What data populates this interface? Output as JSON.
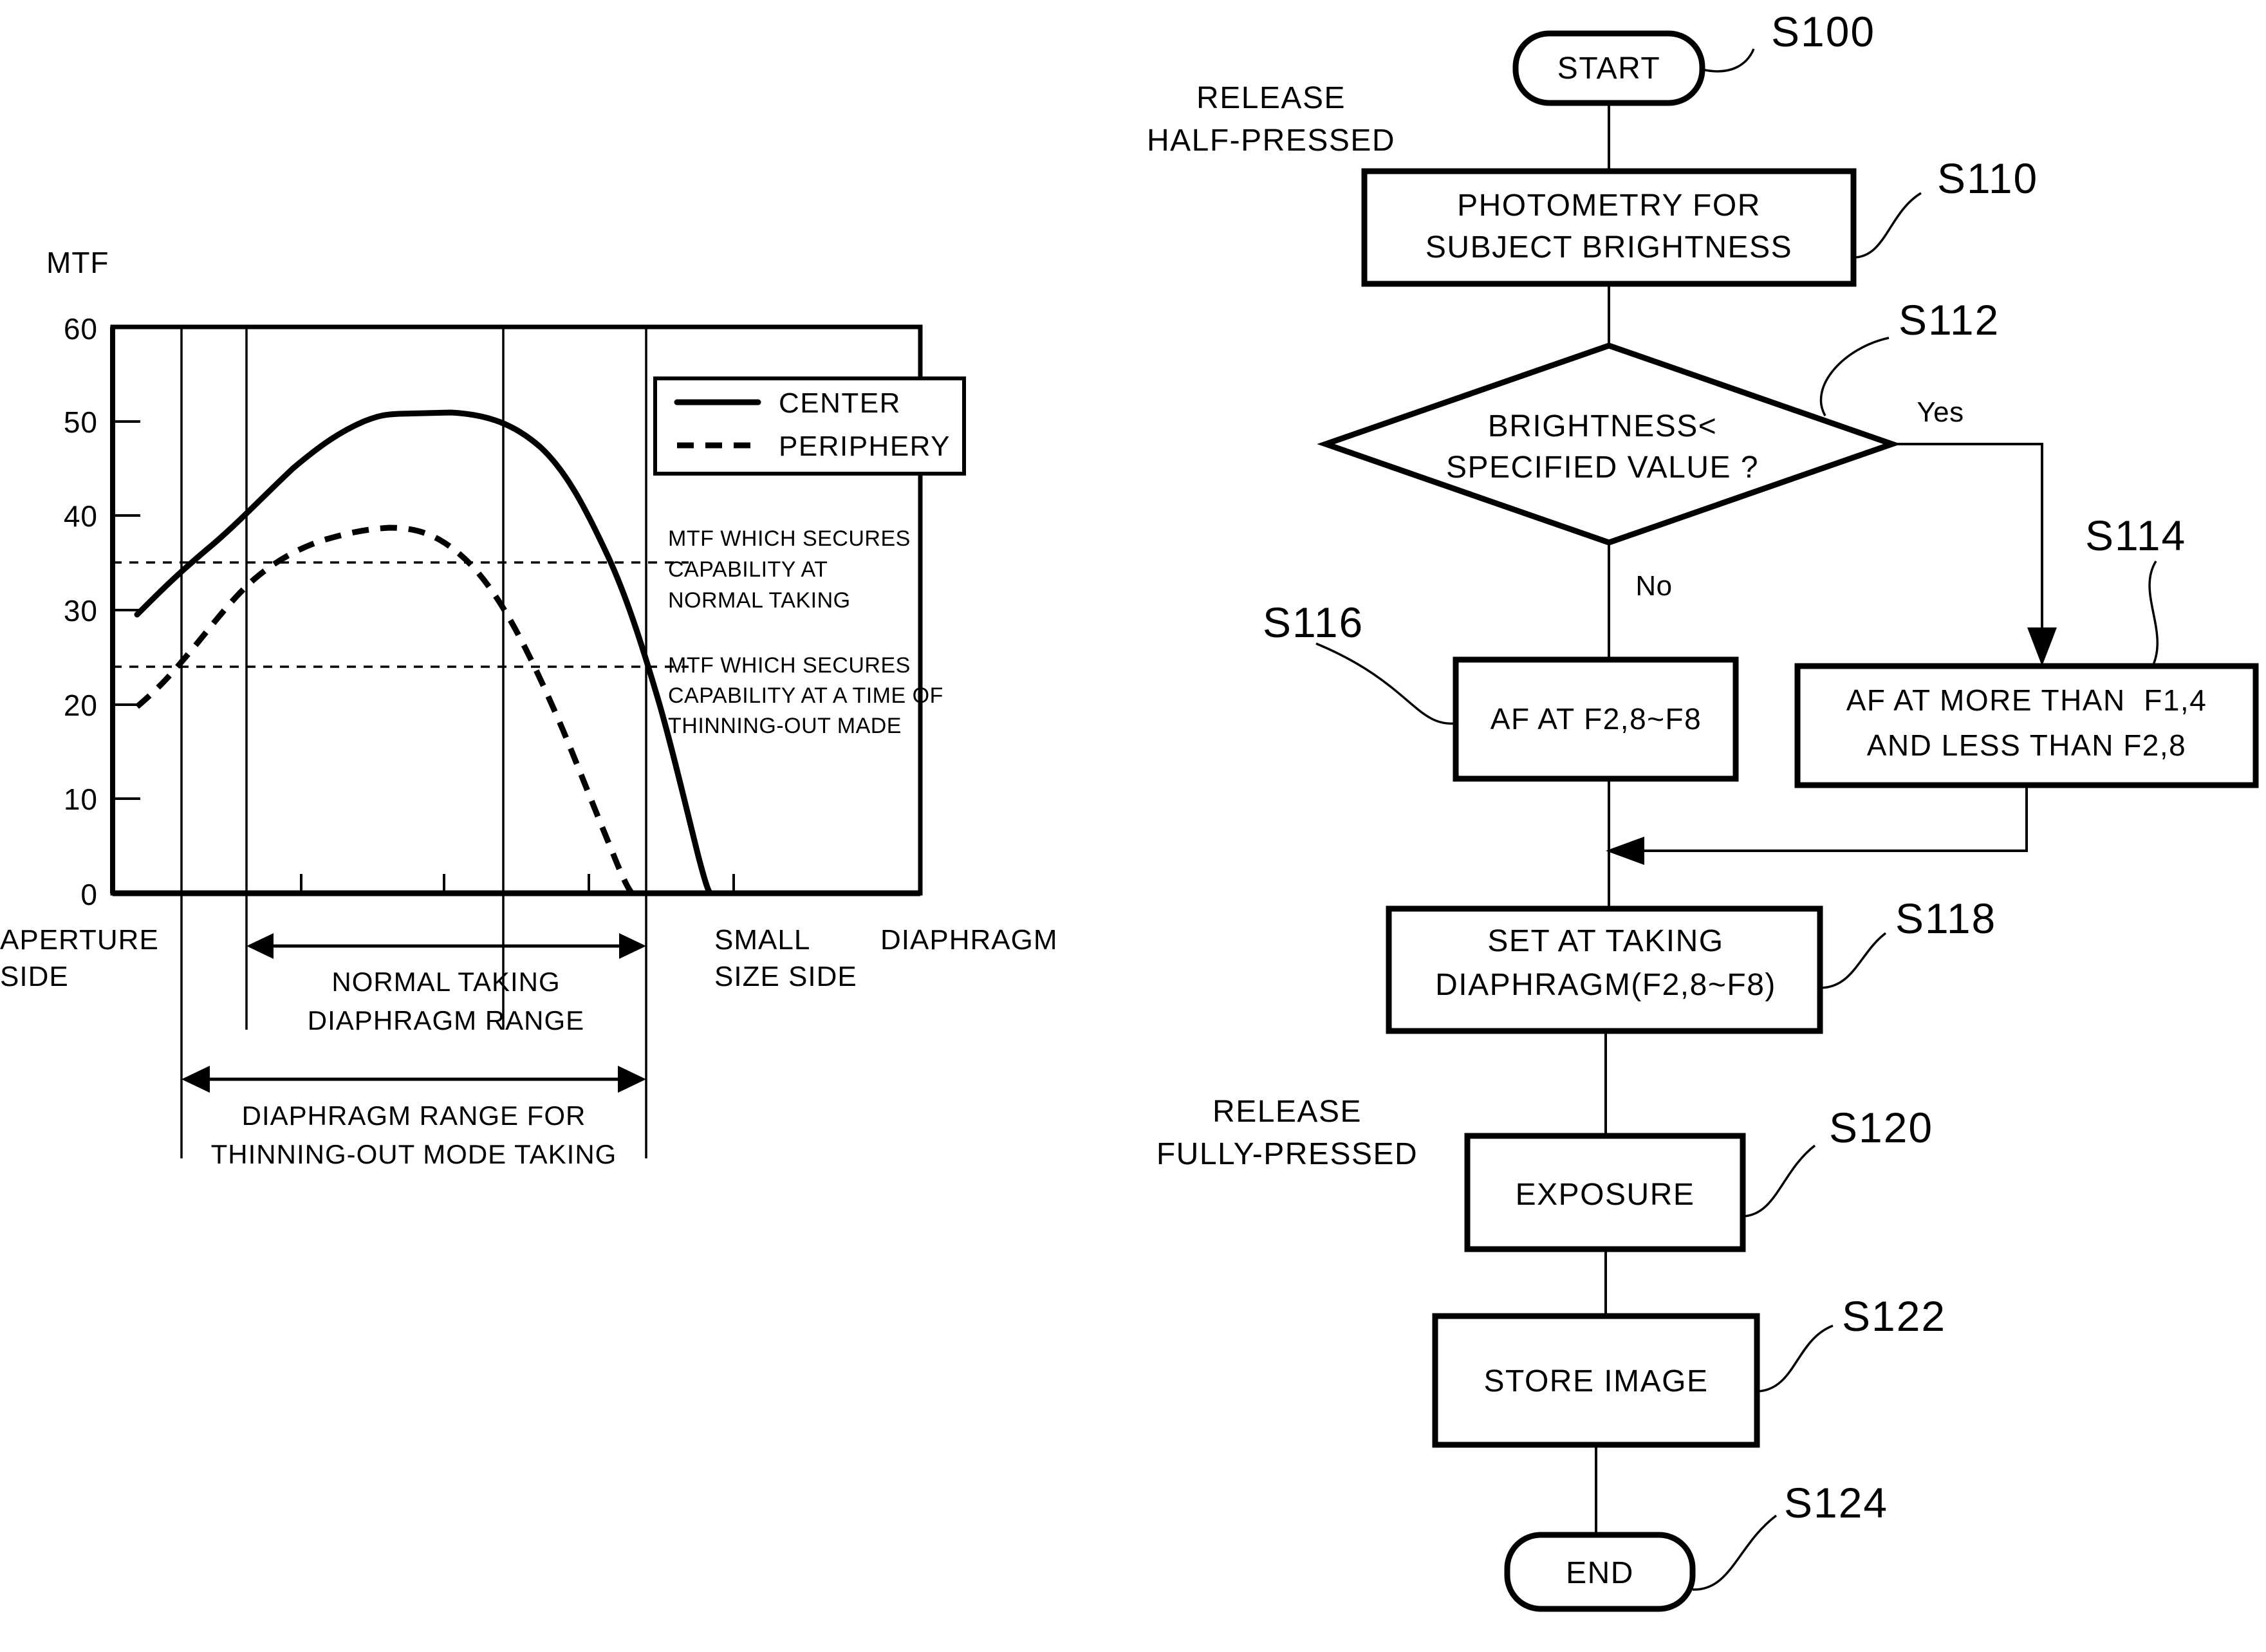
{
  "figure": {
    "type": "patent-figure",
    "panels": [
      "mtf-graph",
      "flowchart"
    ]
  },
  "chart_data": {
    "type": "line",
    "title": "",
    "ylabel": "MTF",
    "xlabel": "DIAPHRAGM",
    "ylim": [
      0,
      60
    ],
    "yticks": [
      "0",
      "10",
      "20",
      "30",
      "40",
      "50",
      "60"
    ],
    "grid": true,
    "legend_position": "top-right",
    "x_axis_left_label": "APERTURE SIDE",
    "x_axis_right_label": "SMALL SIZE SIDE",
    "series": [
      {
        "name": "CENTER",
        "style": "solid",
        "points": [
          [
            0.03,
            29.5
          ],
          [
            0.09,
            33.0
          ],
          [
            0.14,
            35.5
          ],
          [
            0.2,
            38.8
          ],
          [
            0.27,
            42.5
          ],
          [
            0.34,
            45.8
          ],
          [
            0.41,
            48.5
          ],
          [
            0.47,
            50.5
          ],
          [
            0.53,
            51.5
          ],
          [
            0.6,
            51.8
          ],
          [
            0.66,
            51.5
          ],
          [
            0.72,
            50.2
          ],
          [
            0.78,
            47.8
          ],
          [
            0.84,
            44.0
          ],
          [
            0.89,
            39.0
          ],
          [
            0.94,
            32.0
          ],
          [
            0.98,
            24.0
          ],
          [
            1.02,
            14.0
          ],
          [
            1.06,
            4.0
          ],
          [
            1.08,
            0.0
          ]
        ]
      },
      {
        "name": "PERIPHERY",
        "style": "dashed",
        "points": [
          [
            0.03,
            19.8
          ],
          [
            0.09,
            22.5
          ],
          [
            0.14,
            24.5
          ],
          [
            0.2,
            29.0
          ],
          [
            0.27,
            33.5
          ],
          [
            0.34,
            36.5
          ],
          [
            0.41,
            38.2
          ],
          [
            0.47,
            39.5
          ],
          [
            0.53,
            40.4
          ],
          [
            0.6,
            40.5
          ],
          [
            0.66,
            39.5
          ],
          [
            0.72,
            37.5
          ],
          [
            0.78,
            35.0
          ],
          [
            0.84,
            31.2
          ],
          [
            0.89,
            26.5
          ],
          [
            0.94,
            21.0
          ],
          [
            0.98,
            15.0
          ],
          [
            1.02,
            8.0
          ],
          [
            1.05,
            2.0
          ],
          [
            1.07,
            0.0
          ]
        ]
      }
    ],
    "threshold_lines": [
      {
        "value": 35,
        "label": "MTF WHICH SECURES CAPABILITY AT NORMAL TAKING"
      },
      {
        "value": 24,
        "label": "MTF WHICH SECURES CAPABILITY AT A TIME OF THINNING-OUT MADE"
      }
    ],
    "vertical_gridlines": [
      0.085,
      0.175,
      0.52,
      0.71
    ],
    "annotations": [
      {
        "id": "normal-taking-range",
        "lines": [
          "NORMAL TAKING",
          "DIAPHRAGM RANGE"
        ]
      },
      {
        "id": "thinning-out-range",
        "lines": [
          "DIAPHRAGM RANGE FOR",
          "THINNING-OUT MODE TAKING"
        ]
      }
    ]
  },
  "graph": {
    "y_axis_title": "MTF",
    "y_ticks": [
      {
        "value": 60,
        "label": "60"
      },
      {
        "value": 50,
        "label": "50"
      },
      {
        "value": 40,
        "label": "40"
      },
      {
        "value": 30,
        "label": "30"
      },
      {
        "value": 20,
        "label": "20"
      },
      {
        "value": 10,
        "label": "10"
      },
      {
        "value": 0,
        "label": "0"
      }
    ],
    "legend": [
      {
        "label": "CENTER",
        "style": "solid"
      },
      {
        "label": "PERIPHERY",
        "style": "dashed"
      }
    ],
    "annotation_normal": {
      "line1": "MTF WHICH SECURES",
      "line2": "CAPABILITY AT",
      "line3": "NORMAL TAKING"
    },
    "annotation_thinning": {
      "line1": "MTF WHICH SECURES",
      "line2": "CAPABILITY AT A TIME OF",
      "line3": "THINNING-OUT MADE"
    },
    "x_left": {
      "line1": "APERTURE",
      "line2": "SIDE"
    },
    "x_right": {
      "line1": "SMALL",
      "line2": "SIZE SIDE"
    },
    "x_title": "DIAPHRAGM",
    "range_normal": {
      "line1": "NORMAL TAKING",
      "line2": "DIAPHRAGM RANGE"
    },
    "range_thinning": {
      "line1": "DIAPHRAGM RANGE FOR",
      "line2": "THINNING-OUT MODE TAKING"
    }
  },
  "flowchart": {
    "side_labels": [
      {
        "id": "release-half-pressed",
        "line1": "RELEASE",
        "line2": "HALF-PRESSED"
      },
      {
        "id": "release-fully-pressed",
        "line1": "RELEASE",
        "line2": "FULLY-PRESSED"
      }
    ],
    "nodes": [
      {
        "id": "start",
        "shape": "terminator",
        "label": "START",
        "step": "S100"
      },
      {
        "id": "photometry",
        "shape": "process",
        "line1": "PHOTOMETRY FOR",
        "line2": "SUBJECT BRIGHTNESS",
        "step": "S110"
      },
      {
        "id": "decision",
        "shape": "decision",
        "line1": "BRIGHTNESS<",
        "line2": "SPECIFIED VALUE ?",
        "step": "S112"
      },
      {
        "id": "af-bright",
        "shape": "process",
        "label": "AF AT F2,8~F8",
        "step": "S116"
      },
      {
        "id": "af-dark",
        "shape": "process",
        "line1": "AF AT MORE THAN  F1,4",
        "line2": "AND LESS THAN F2,8",
        "step": "S114"
      },
      {
        "id": "set-taking",
        "shape": "process",
        "line1": "SET AT TAKING",
        "line2": "DIAPHRAGM(F2,8~F8)",
        "step": "S118"
      },
      {
        "id": "exposure",
        "shape": "process",
        "label": "EXPOSURE",
        "step": "S120"
      },
      {
        "id": "store",
        "shape": "process",
        "label": "STORE IMAGE",
        "step": "S122"
      },
      {
        "id": "end",
        "shape": "terminator",
        "label": "END",
        "step": "S124"
      }
    ],
    "branch_labels": [
      {
        "id": "yes-branch",
        "label": "Yes"
      },
      {
        "id": "no-branch",
        "label": "No"
      }
    ]
  }
}
